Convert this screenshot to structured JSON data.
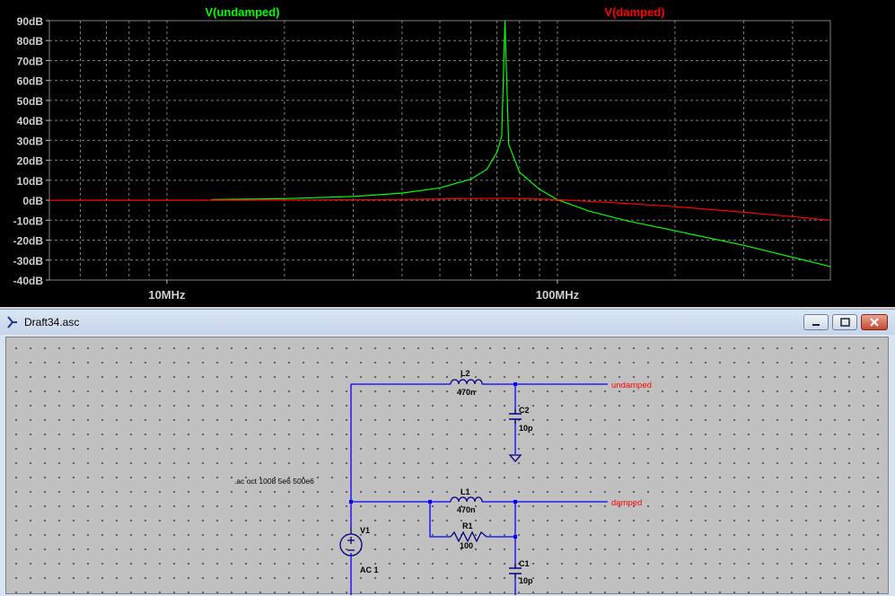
{
  "plot": {
    "traces": [
      {
        "name": "V(undamped)",
        "color": "#00ff00"
      },
      {
        "name": "V(damped)",
        "color": "#ff0000"
      }
    ],
    "y_ticks": [
      "90dB",
      "80dB",
      "70dB",
      "60dB",
      "50dB",
      "40dB",
      "30dB",
      "20dB",
      "10dB",
      "0dB",
      "-10dB",
      "-20dB",
      "-30dB",
      "-40dB"
    ],
    "x_ticks": [
      "10MHz",
      "100MHz"
    ],
    "background": "#000000",
    "grid_color": "#808080"
  },
  "chart_data": {
    "type": "line",
    "xscale": "log",
    "xlim": [
      "5MHz",
      "500MHz"
    ],
    "ylim": [
      -40,
      90
    ],
    "ylabel_unit": "dB",
    "series": [
      {
        "name": "V(undamped)",
        "color": "#00ff00",
        "x_mhz": [
          13,
          20,
          30,
          40,
          50,
          60,
          66,
          70,
          72,
          73.4,
          75,
          80,
          90,
          100,
          120,
          150,
          200,
          300,
          500
        ],
        "y_db": [
          0.3,
          0.8,
          1.9,
          3.6,
          6.2,
          10.5,
          15.5,
          24,
          32,
          90,
          28,
          14,
          5.5,
          0.3,
          -5.3,
          -10.2,
          -15.3,
          -22.6,
          -33.2
        ]
      },
      {
        "name": "V(damped)",
        "color": "#ff0000",
        "x_mhz": [
          5,
          10,
          20,
          40,
          60,
          73,
          80,
          100,
          150,
          200,
          300,
          500
        ],
        "y_db": [
          0,
          0,
          0.1,
          0.4,
          0.8,
          1.0,
          0.9,
          0.3,
          -1.6,
          -3.2,
          -6.0,
          -10.0
        ]
      }
    ]
  },
  "window": {
    "title": "Draft34.asc"
  },
  "schematic": {
    "spice_directive": ".ac oct 1008 5e6 500e6",
    "components": {
      "L2": {
        "name": "L2",
        "value": "470n"
      },
      "C2": {
        "name": "C2",
        "value": "10p"
      },
      "L1": {
        "name": "L1",
        "value": "470n"
      },
      "R1": {
        "name": "R1",
        "value": "100"
      },
      "C1": {
        "name": "C1",
        "value": "10p"
      },
      "V1": {
        "name": "V1",
        "value": "AC 1"
      }
    },
    "net_labels": {
      "undamped": "undamped",
      "damped": "damped"
    },
    "wire_color": "#0000ff",
    "net_label_color": "#ff0000"
  }
}
